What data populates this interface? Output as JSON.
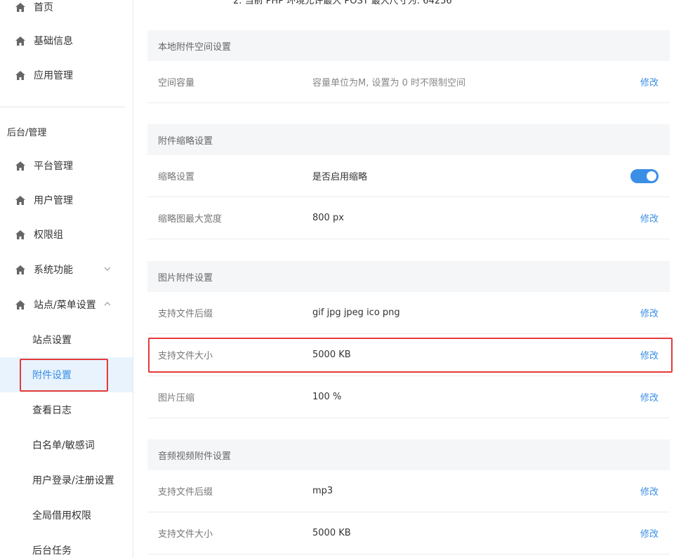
{
  "top_note": "2. 当前 PHP 环境允许最大 POST 最大尺寸为: 64256",
  "sidebar": {
    "items_top": [
      {
        "label": "首页",
        "icon": "home-icon"
      },
      {
        "label": "基础信息",
        "icon": "home-icon"
      },
      {
        "label": "应用管理",
        "icon": "home-icon"
      }
    ],
    "group_title": "后台/管理",
    "items_admin": [
      {
        "label": "平台管理",
        "icon": "home-icon"
      },
      {
        "label": "用户管理",
        "icon": "home-icon"
      },
      {
        "label": "权限组",
        "icon": "home-icon"
      },
      {
        "label": "系统功能",
        "icon": "home-icon"
      },
      {
        "label": "站点/菜单设置",
        "icon": "home-icon"
      }
    ],
    "sub_items": [
      {
        "label": "站点设置"
      },
      {
        "label": "附件设置"
      },
      {
        "label": "查看日志"
      },
      {
        "label": "白名单/敏感词"
      },
      {
        "label": "用户登录/注册设置"
      },
      {
        "label": "全局借用权限"
      },
      {
        "label": "后台任务"
      }
    ],
    "active_color": "#3a8ee6"
  },
  "sections": [
    {
      "title": "本地附件空间设置",
      "rows": [
        {
          "label": "空间容量",
          "value": "容量单位为M, 设置为 0 时不限制空间",
          "action": "修改"
        }
      ]
    },
    {
      "title": "附件缩略设置",
      "rows": [
        {
          "label": "缩略设置",
          "value": "是否启用缩略",
          "toggle": "on"
        },
        {
          "label": "缩略图最大宽度",
          "value": "800 px",
          "action": "修改"
        }
      ]
    },
    {
      "title": "图片附件设置",
      "rows": [
        {
          "label": "支持文件后缀",
          "value": "gif jpg jpeg ico png",
          "action": "修改"
        },
        {
          "label": "支持文件大小",
          "value": "5000 KB",
          "action": "修改"
        },
        {
          "label": "图片压缩",
          "value": "100 %",
          "action": "修改"
        }
      ]
    },
    {
      "title": "音频视频附件设置",
      "rows": [
        {
          "label": "支持文件后缀",
          "value": "mp3",
          "action": "修改"
        },
        {
          "label": "支持文件大小",
          "value": "5000 KB",
          "action": "修改"
        }
      ]
    }
  ],
  "colors": {
    "accent": "#3a8ee6",
    "highlight": "#e53a3a",
    "section_bg": "#f5f6f8"
  }
}
